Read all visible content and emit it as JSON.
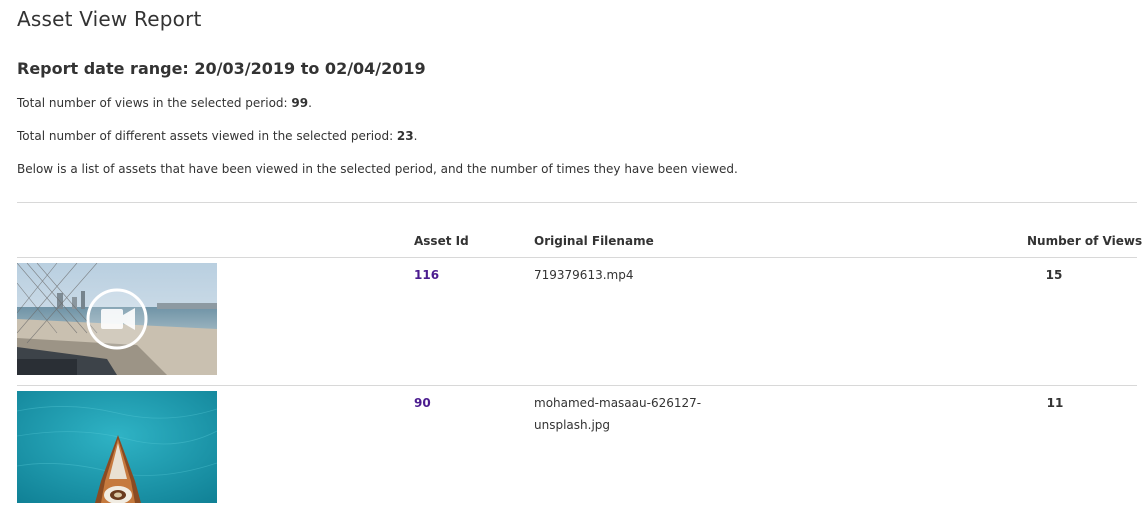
{
  "page": {
    "title": "Asset View Report",
    "date_range": "Report date range: 20/03/2019 to 02/04/2019"
  },
  "summary": {
    "views_prefix": "Total number of views in the selected period: ",
    "views_value": "99",
    "views_suffix": ".",
    "assets_prefix": "Total number of different assets viewed in the selected period: ",
    "assets_value": "23",
    "assets_suffix": ".",
    "description": "Below is a list of assets that have been viewed in the selected period, and the number of times they have been viewed."
  },
  "table": {
    "headers": {
      "asset_id": "Asset Id",
      "filename": "Original Filename",
      "views": "Number of Views"
    },
    "rows": [
      {
        "asset_id": "116",
        "filename": "719379613.mp4",
        "views": "15",
        "thumb_icon": "video-camera-icon"
      },
      {
        "asset_id": "90",
        "filename": "mohamed-masaau-626127-unsplash.jpg",
        "filename_line1": "mohamed-masaau-626127-",
        "filename_line2": "unsplash.jpg",
        "views": "11",
        "thumb_icon": "boat-photo"
      }
    ]
  },
  "colors": {
    "link": "#4b1c8f",
    "rule": "#d8d8d8",
    "text": "#333333"
  }
}
